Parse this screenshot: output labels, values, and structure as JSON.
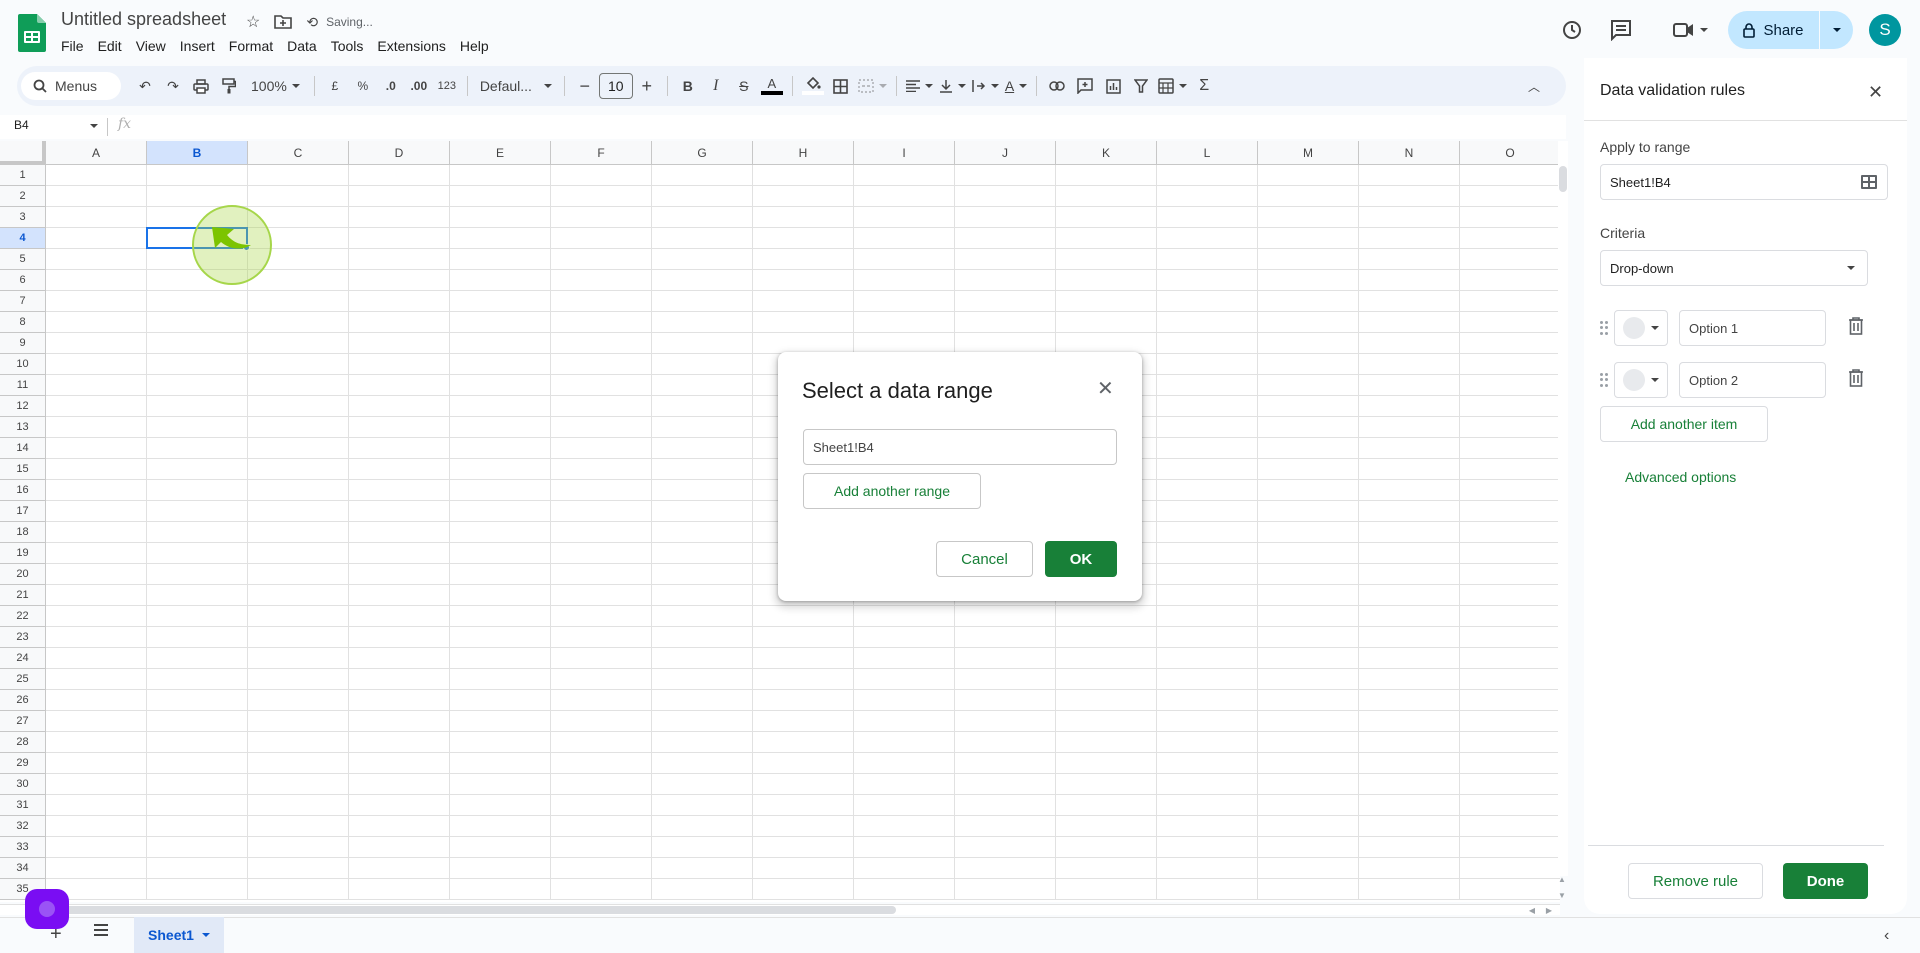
{
  "header": {
    "title": "Untitled spreadsheet",
    "status": "Saving...",
    "share_label": "Share",
    "avatar_initial": "S",
    "menu": [
      "File",
      "Edit",
      "View",
      "Insert",
      "Format",
      "Data",
      "Tools",
      "Extensions",
      "Help"
    ]
  },
  "toolbar": {
    "search_label": "Menus",
    "zoom": "100%",
    "currency": "£",
    "percent": "%",
    "decrease_decimal": ".0",
    "increase_decimal": ".00",
    "number_format": "123",
    "font": "Defaul...",
    "font_size": "10",
    "bold": "B",
    "italic": "I",
    "sum": "Σ",
    "text_color": "#000000",
    "fill_color": "#ffffff"
  },
  "formula_bar": {
    "cell_ref": "B4",
    "fx": "fx",
    "value": ""
  },
  "grid": {
    "columns": [
      "A",
      "B",
      "C",
      "D",
      "E",
      "F",
      "G",
      "H",
      "I",
      "J",
      "K",
      "L",
      "M",
      "N",
      "O"
    ],
    "rows": [
      "1",
      "2",
      "3",
      "4",
      "5",
      "6",
      "7",
      "8",
      "9",
      "10",
      "11",
      "12",
      "13",
      "14",
      "15",
      "16",
      "17",
      "18",
      "19",
      "20",
      "21",
      "22",
      "23",
      "24",
      "25",
      "26",
      "27",
      "28",
      "29",
      "30",
      "31",
      "32",
      "33",
      "34",
      "35"
    ],
    "selected_column": "B",
    "selected_row": "4"
  },
  "sheets": {
    "tabs": [
      {
        "name": "Sheet1",
        "active": true
      }
    ]
  },
  "dialog": {
    "title": "Select a data range",
    "range_value": "Sheet1!B4",
    "add_range_label": "Add another range",
    "cancel_label": "Cancel",
    "ok_label": "OK"
  },
  "panel": {
    "title": "Data validation rules",
    "apply_label": "Apply to range",
    "apply_value": "Sheet1!B4",
    "criteria_label": "Criteria",
    "criteria_value": "Drop-down",
    "options": [
      {
        "value": "Option 1",
        "color": "#e8eaed"
      },
      {
        "value": "Option 2",
        "color": "#e8eaed"
      }
    ],
    "add_item_label": "Add another item",
    "advanced_label": "Advanced options",
    "remove_label": "Remove rule",
    "done_label": "Done"
  },
  "colors": {
    "accent_green": "#188038",
    "selection_blue": "#1a73e8",
    "share_bg": "#c2e7ff"
  }
}
